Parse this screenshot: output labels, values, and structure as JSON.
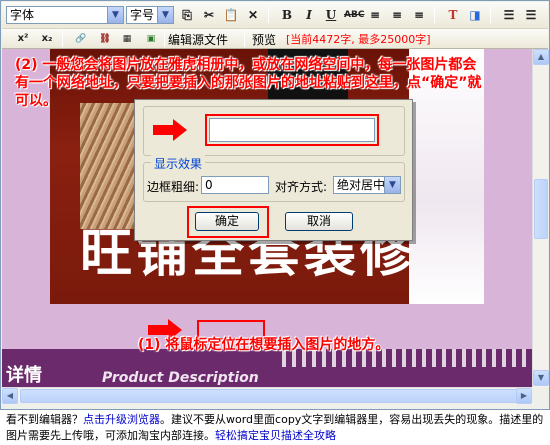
{
  "toolbar": {
    "font_select": "字体",
    "size_select": "字号",
    "edit_source_label": "编辑源文件",
    "preview_label": "预览",
    "char_counter": "[当前4472字, 最多25000字]",
    "superscript": "x²",
    "subscript": "x₂"
  },
  "annotations": {
    "step2": "(2) 一般您会将图片放在雅虎相册中，或放在网络空间中，每一张图片都会有一个网络地址，只要把要插入的那张图片的地址粘贴到这里，点“确定”就可以。",
    "step1": "(1) 将鼠标定位在想要插入图片的地方。"
  },
  "editor_content": {
    "headline": "旺铺全套装修",
    "section_title": "详情",
    "section_subtitle": "Product Description"
  },
  "dialog": {
    "display_legend": "显示效果",
    "border_label": "边框粗细:",
    "border_value": "0",
    "align_label": "对齐方式:",
    "align_value": "绝对居中",
    "ok_label": "确定",
    "cancel_label": "取消",
    "url_value": ""
  },
  "footer": {
    "line1_a": "看不到编辑器？",
    "link_upgrade": "点击升级浏览器",
    "line1_b": "。建议不要从word里面copy文字到编辑器里，容易出现丢失的现象。描述里的图片需要先上传哦，可添加淘宝内部连接。",
    "link_guide": "轻松搞定宝贝描述全攻略"
  },
  "colors": {
    "annotation": "#ff0000",
    "link": "#0000cc",
    "legend": "#0046d5"
  }
}
